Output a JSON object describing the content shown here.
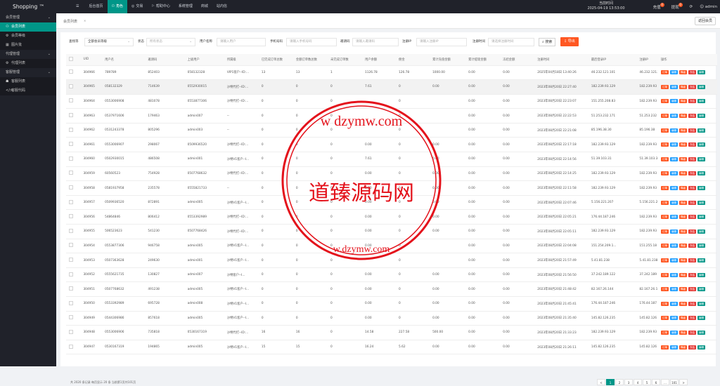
{
  "brand": "Shopping ™",
  "nav": [
    {
      "icon": "☰",
      "label": ""
    },
    {
      "icon": "",
      "label": "后台首页"
    },
    {
      "icon": "⚇",
      "label": "角色"
    },
    {
      "icon": "◎",
      "label": "交易"
    },
    {
      "icon": "⚐",
      "label": "帮助中心"
    },
    {
      "icon": "",
      "label": "系统管理"
    },
    {
      "icon": "",
      "label": "商城"
    },
    {
      "icon": "",
      "label": "站内信"
    }
  ],
  "header": {
    "time_label": "当前时间",
    "time_value": "2025-04-19 13:53:00",
    "recharge": "充值",
    "recharge_badge": "0",
    "withdraw": "提现",
    "withdraw_badge": "0",
    "refresh_icon": "⟳",
    "user": "admin"
  },
  "sidebar": [
    {
      "type": "group",
      "label": "会员管理",
      "chev": "⌄"
    },
    {
      "type": "item",
      "label": "会员列表",
      "icon": "⚇",
      "active": true
    },
    {
      "type": "item",
      "label": "会员等级",
      "icon": "⚙"
    },
    {
      "type": "item",
      "label": "图片批",
      "icon": "▦"
    },
    {
      "type": "group",
      "label": "代理管理",
      "chev": "⌄"
    },
    {
      "type": "item",
      "label": "代理列表",
      "icon": "⚙"
    },
    {
      "type": "group",
      "label": "客服管理",
      "chev": "⌄"
    },
    {
      "type": "item",
      "label": "客服列表",
      "icon": "☗"
    },
    {
      "type": "item",
      "label": "客服代码",
      "icon": "</>"
    }
  ],
  "tab": {
    "title": "会员列表",
    "close": "✕",
    "back": "返回会员"
  },
  "filters": {
    "l1": "查找等",
    "v1": "全部会员等级",
    "l2": "状态",
    "v2": "所有状态",
    "l3": "用户名称",
    "p3": "请输入用户",
    "l4": "手机号码",
    "p4": "请输入手机号码",
    "l5": "邀请码",
    "p5": "请输入邀请码",
    "l6": "注册IP",
    "p6": "请输入注册IP",
    "l7": "注册时间",
    "p7": "请选择注册时间",
    "search": "搜索",
    "export": "导出"
  },
  "table": {
    "headers": [
      "",
      "UID",
      "用户名",
      "邀请码",
      "上级用户",
      "所属级",
      "已完成订单总数",
      "金额订单数总数",
      "未完成订单数",
      "用户余额",
      "佣金",
      "累计充值金额",
      "累计提现金额",
      "冻结金额",
      "注册时间",
      "最后登录IP",
      "注册IP",
      "操作"
    ],
    "rows": [
      [
        "304966",
        "789789",
        "852403",
        "058132328",
        "VIP1客户--ID:...",
        "13",
        "13",
        "1",
        "1126.78",
        "126.78",
        "1000.00",
        "0.00",
        "0.00",
        "2025年04月18日 13:40:26",
        "46.232.121.101",
        "46.232.121.1"
      ],
      [
        "304965",
        "058132329",
        "714639",
        "0552930015",
        "沙特代打--ID:...",
        "0",
        "0",
        "0",
        "7.61",
        "0",
        "0.00",
        "0.00",
        "0.00",
        "2023年08月20日 22:27:40",
        "182.239.93.129",
        "182.239.93"
      ],
      [
        "304964",
        "0553006908",
        "481078",
        "0553877306",
        "沙特代打--ID:...",
        "0",
        "0",
        "0",
        "",
        "0",
        "",
        "0.00",
        "0.00",
        "2023年08月20日 22:23:07",
        "151.255.208.83",
        "182.239.93"
      ],
      [
        "304963",
        "0537971606",
        "179463",
        "admin007",
        "--",
        "0",
        "0",
        "0",
        "",
        "0",
        "",
        "0.00",
        "0.00",
        "2023年08月20日 22:22:53",
        "51.253.232.171",
        "51.253.232"
      ],
      [
        "304962",
        "0531243378",
        "805296",
        "admin003",
        "--",
        "0",
        "0",
        "0",
        "",
        "0",
        "",
        "0.00",
        "0.00",
        "2023年08月20日 22:21:08",
        "85.196.38.30",
        "85.196.38"
      ],
      [
        "304961",
        "0553006907",
        "298067",
        "0509936520",
        "沙特代打--ID:...",
        "0",
        "0",
        "0",
        "0.00",
        "0",
        "0.00",
        "0.00",
        "0.00",
        "2023年08月20日 22:17:18",
        "182.239.93.129",
        "182.239.93"
      ],
      [
        "304960",
        "0502930015",
        "486508",
        "admin001",
        "沙特V1客户--I...",
        "0",
        "0",
        "0",
        "7.61",
        "0",
        "0.00",
        "0.00",
        "0.00",
        "2023年08月20日 22:14:56",
        "51.39.103.31",
        "51.39.103.3"
      ],
      [
        "304959",
        "60560523",
        "754928",
        "0507768632",
        "沙特代打--ID:...",
        "0",
        "0",
        "0",
        "0.00",
        "0",
        "0.00",
        "0.00",
        "0.00",
        "2023年08月20日 22:14:25",
        "182.239.93.129",
        "182.239.93"
      ],
      [
        "304958",
        "0581937958",
        "235578",
        "0555821733",
        "--",
        "0",
        "0",
        "0",
        "0.00",
        "0",
        "0.00",
        "0.00",
        "0.00",
        "2023年08月20日 22:11:58",
        "182.239.93.129",
        "182.239.93"
      ],
      [
        "304957",
        "0509936520",
        "872891",
        "admin005",
        "沙特V1客户--I...",
        "0",
        "0",
        "0",
        "0.00",
        "0",
        "0.00",
        "0.00",
        "0.00",
        "2023年08月20日 22:07:46",
        "5.156.221.207",
        "5.156.221.2"
      ],
      [
        "304956",
        "54864846",
        "806412",
        "0553392989",
        "沙特代打--ID:...",
        "0",
        "0",
        "0",
        "0.00",
        "0",
        "0.00",
        "0.00",
        "0.00",
        "2023年08月20日 22:05:21",
        "176.44.187.246",
        "182.239.93"
      ],
      [
        "304955",
        "506523623",
        "541230",
        "0507768426",
        "沙特代打--ID:...",
        "0",
        "0",
        "0",
        "0.00",
        "0",
        "0.00",
        "0.00",
        "0.00",
        "2023年08月20日 22:05:11",
        "182.239.93.129",
        "182.239.93"
      ],
      [
        "304954",
        "0553877306",
        "946758",
        "admin005",
        "沙特V1客户--I...",
        "0",
        "0",
        "0",
        "0.00",
        "0",
        "",
        "0.00",
        "0.00",
        "2023年08月20日 22:04:08",
        "151.254.209.1...",
        "151.255.18"
      ],
      [
        "304953",
        "0507363628",
        "249630",
        "admin001",
        "沙特V1客户--I...",
        "0",
        "0",
        "0",
        "",
        "0",
        "",
        "0.00",
        "0.00",
        "2023年08月20日 21:57:49",
        "5.41.81.238",
        "5.41.81.238"
      ],
      [
        "304952",
        "0555621735",
        "130827",
        "admin007",
        "沙特客户--I...",
        "0",
        "0",
        "0",
        "0.00",
        "0",
        "0.00",
        "0.00",
        "0.00",
        "2023年08月20日 21:56:50",
        "37.242.189.122",
        "37.242.189"
      ],
      [
        "304951",
        "0507768632",
        "491238",
        "admin005",
        "沙特V1客户--I...",
        "0",
        "0",
        "0",
        "0.00",
        "0",
        "0.00",
        "0.00",
        "0.00",
        "2023年08月20日 21:48:42",
        "82.167.26.144",
        "82.167.26.1"
      ],
      [
        "304950",
        "0553392989",
        "695728",
        "admin008",
        "沙特V1客户--I...",
        "0",
        "0",
        "0",
        "0.00",
        "0",
        "0.00",
        "0.00",
        "0.00",
        "2023年08月20日 21:45:41",
        "176.44.187.246",
        "176.44.187"
      ],
      [
        "304949",
        "0544306986",
        "857618",
        "admin005",
        "沙特V1客户--I...",
        "0",
        "0",
        "0",
        "0.00",
        "0",
        "0.00",
        "0.00",
        "0.00",
        "2023年08月20日 21:35:40",
        "145.82.126.235",
        "145.82.126"
      ],
      [
        "304948",
        "0553006906",
        "735818",
        "0530167319",
        "沙特代打--ID:...",
        "16",
        "16",
        "0",
        "14.58",
        "227.58",
        "500.00",
        "0.00",
        "0.00",
        "2023年08月20日 21:33:23",
        "182.239.93.129",
        "182.239.93"
      ],
      [
        "304947",
        "0530167319",
        "194865",
        "admin005",
        "沙特V1客户--I...",
        "15",
        "15",
        "0",
        "16.24",
        "5.62",
        "0.00",
        "0.00",
        "0.00",
        "2023年08月20日 21:26:11",
        "145.82.126.235",
        "145.82.126"
      ]
    ],
    "ops": [
      "订单",
      "编辑",
      "降级",
      "冻结",
      "编辑"
    ]
  },
  "pager": {
    "info": "共 2020 条记录 每页显示 20 条 当前第1页共101页",
    "pages": [
      "<",
      "1",
      "2",
      "3",
      "4",
      "5",
      "6",
      "...",
      "101",
      ">"
    ]
  },
  "watermark": {
    "top": "w dzymw.com",
    "bottom": "w.dzymw.com",
    "center": "道臻源码网",
    "color": "#e4121b"
  }
}
